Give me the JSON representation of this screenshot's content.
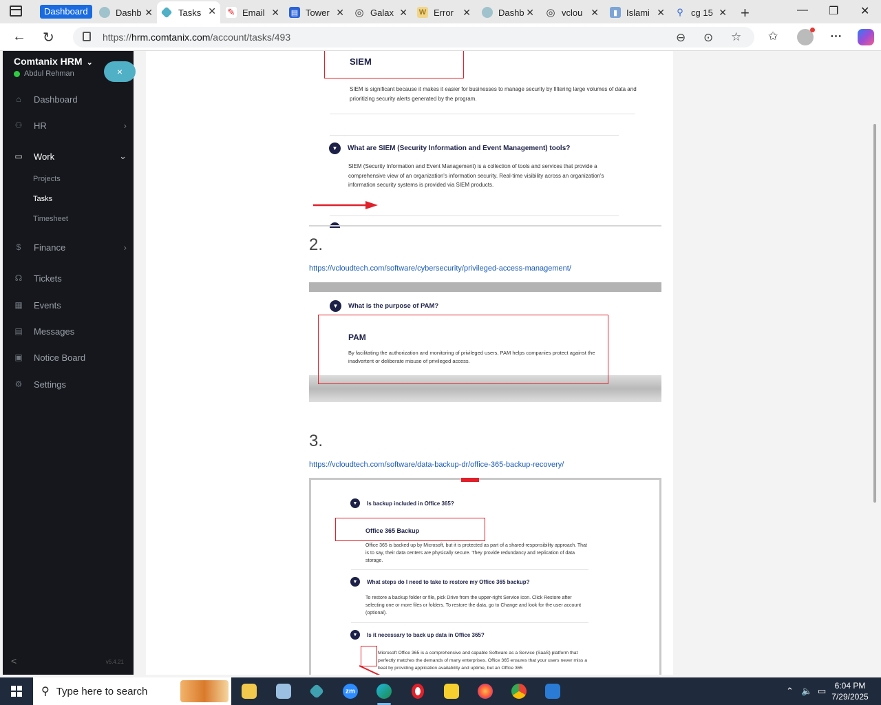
{
  "browser": {
    "tabs": [
      {
        "label": "Dashboard",
        "favicon": "dashboard-badge-icon"
      },
      {
        "label": "Dashb",
        "favicon": "comtanix-icon"
      },
      {
        "label": "Tasks",
        "favicon": "comtanix-icon"
      },
      {
        "label": "Email",
        "favicon": "email-icon"
      },
      {
        "label": "Tower",
        "favicon": "tower-icon"
      },
      {
        "label": "Galax",
        "favicon": "globe-icon"
      },
      {
        "label": "Error",
        "favicon": "w-icon"
      },
      {
        "label": "Dashb",
        "favicon": "comtanix-icon"
      },
      {
        "label": "vclou",
        "favicon": "globe-icon"
      },
      {
        "label": "Islami",
        "favicon": "bookmark-icon"
      },
      {
        "label": "cg 15",
        "favicon": "search-icon"
      }
    ],
    "address": {
      "prefix": "https://",
      "host": "hrm.comtanix.com",
      "path": "/account/tasks/493"
    }
  },
  "app": {
    "brand": "Comtanix HRM",
    "user": "Abdul Rehman",
    "close_label": "×",
    "nav": {
      "dashboard": "Dashboard",
      "hr": "HR",
      "work": "Work",
      "projects": "Projects",
      "tasks": "Tasks",
      "timesheet": "Timesheet",
      "finance": "Finance",
      "tickets": "Tickets",
      "events": "Events",
      "messages": "Messages",
      "notice_board": "Notice Board",
      "settings": "Settings"
    },
    "collapse_label": "<",
    "version": "v5.4.21"
  },
  "content": {
    "siem_box_title": "SIEM",
    "siem_box_text": "SIEM is significant because it makes it easier for businesses to manage security by filtering large volumes of data and prioritizing security alerts generated by the program.",
    "siem_question": "What are SIEM (Security Information and Event Management) tools?",
    "siem_answer": "SIEM (Security Information and Event Management) is a collection of tools and services that provide a comprehensive view of an organization's information security. Real-time visibility across an organization's information security systems is provided via SIEM products.",
    "section2_num": "2.",
    "section2_link": "https://vcloudtech.com/software/cybersecurity/privileged-access-management/",
    "pam_question": "What is the purpose of PAM?",
    "pam_box_title": "PAM",
    "pam_box_text": "By facilitating the authorization and monitoring of privileged users, PAM helps companies protect against the inadvertent or deliberate misuse of privileged access.",
    "section3_num": "3.",
    "section3_link": "https://vcloudtech.com/software/data-backup-dr/office-365-backup-recovery/",
    "o365_q1": "Is backup included in Office 365?",
    "o365_box_title": "Office 365 Backup",
    "o365_a1": "Office 365 is backed up by Microsoft, but it is protected as part of a shared-responsibility approach. That is to say, their data centers are physically secure. They provide redundancy and replication of data storage.",
    "o365_q2": "What steps do I need to take to restore my Office 365 backup?",
    "o365_a2": "To restore a backup folder or file, pick Drive from the upper-right Service icon. Click Restore after selecting one or more files or folders. To restore the data, go to Change and look for the user account (optional).",
    "o365_q3": "Is it necessary to back up data in Office 365?",
    "o365_a3": "Microsoft Office 365 is a comprehensive and capable Software as a Service (SaaS) platform that perfectly matches the demands of many enterprises. Office 365 ensures that your users never miss a beat by providing application availability and uptime, but an Office 365"
  },
  "taskbar": {
    "search_placeholder": "Type here to search",
    "time": "6:04 PM",
    "date": "7/29/2025"
  },
  "colors": {
    "accent": "#4fb0c6",
    "sidebar_bg": "#15171c",
    "annotation_red": "#e0202a",
    "faq_navy": "#1d2147",
    "link_blue": "#1a5bb8"
  }
}
